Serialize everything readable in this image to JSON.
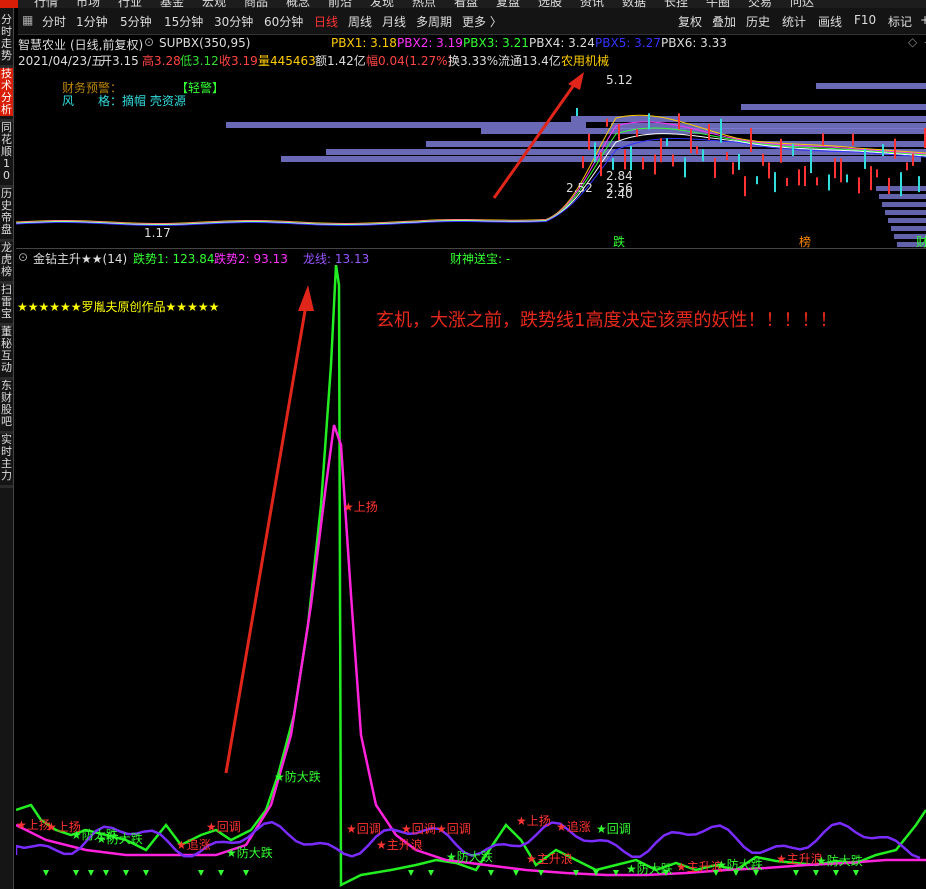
{
  "top_menu": [
    "行情",
    "市场",
    "行业",
    "基金",
    "宏观",
    "商品",
    "概念",
    "前沿",
    "发现",
    "热点",
    "看盘",
    "复盘",
    "选股",
    "资讯",
    "数据",
    "长捏",
    "牛圈",
    "交易",
    "问达"
  ],
  "toolbar": {
    "periods": [
      "分时",
      "1分钟",
      "5分钟",
      "15分钟",
      "30分钟",
      "60分钟",
      "日线",
      "周线",
      "月线",
      "多周期",
      "更多 〉"
    ],
    "active_period": "日线",
    "right": [
      "复权",
      "叠加",
      "历史",
      "统计",
      "画线",
      "F10",
      "标记",
      "+"
    ]
  },
  "sidebar": [
    {
      "label": "分时走势",
      "active": false
    },
    {
      "label": "技术分析",
      "active": true
    },
    {
      "label": "同花顺10",
      "active": false
    },
    {
      "label": "历史帝盘",
      "active": false
    },
    {
      "label": "龙虎榜",
      "active": false
    },
    {
      "label": "扫雷宝",
      "active": false
    },
    {
      "label": "董秘互动",
      "active": false
    },
    {
      "label": "东财股吧",
      "active": false
    },
    {
      "label": "实时主力",
      "active": false
    }
  ],
  "stock": {
    "name": "智慧农业",
    "mode": "(日线,前复权)",
    "indicator": "SUPBX(350,95)",
    "pbx": [
      {
        "label": "PBX1: 3.18",
        "color": "#ffcc00"
      },
      {
        "label": "PBX2: 3.19",
        "color": "#ff33ff"
      },
      {
        "label": "PBX3: 3.21",
        "color": "#33ff33"
      },
      {
        "label": "PBX4: 3.24",
        "color": "#dddddd"
      },
      {
        "label": "PBX5: 3.27",
        "color": "#3333ff"
      },
      {
        "label": "PBX6: 3.33",
        "color": "#dddddd"
      }
    ],
    "date": "2021/04/23/五",
    "open": "开3.15",
    "high": "高3.28",
    "low": "低3.12",
    "close": "收3.19",
    "volume": "量445463",
    "amount": "额1.42亿",
    "change": "幅0.04(1.27%)",
    "turnover": "换3.33%",
    "float": "流通13.4亿",
    "sector": "农用机械"
  },
  "upper_chart": {
    "warning_label": "财务预警：",
    "warning_value": "【轻警】",
    "style_label": "风　　格：",
    "style_value": "摘帽 壳资源",
    "price_labels": [
      "5.12",
      "2.84",
      "2.52",
      "2.56",
      "2.40",
      "1.17"
    ],
    "tags": [
      "跌",
      "榜",
      "财"
    ]
  },
  "lower_chart": {
    "title": "金钻主升★★(14)",
    "line1": "跌势1: 123.84",
    "line2": "跌势2: 93.13",
    "line3": "龙线: 13.13",
    "line4": "财神送宝: -",
    "credit": "★★★★★★罗胤夫原创作品★★★★★",
    "annotation": "玄机，大涨之前，跌势线1高度决定该票的妖性！！！！！",
    "signals": {
      "up": "上扬",
      "drop": "防大跌",
      "adjust": "回调",
      "wave": "主升浪",
      "warn": "防大跌",
      "chase": "追涨"
    }
  },
  "colors": {
    "green": "#22ee22",
    "magenta": "#ff22dd",
    "purple": "#7a2cff",
    "red_arrow": "#e0261a"
  }
}
